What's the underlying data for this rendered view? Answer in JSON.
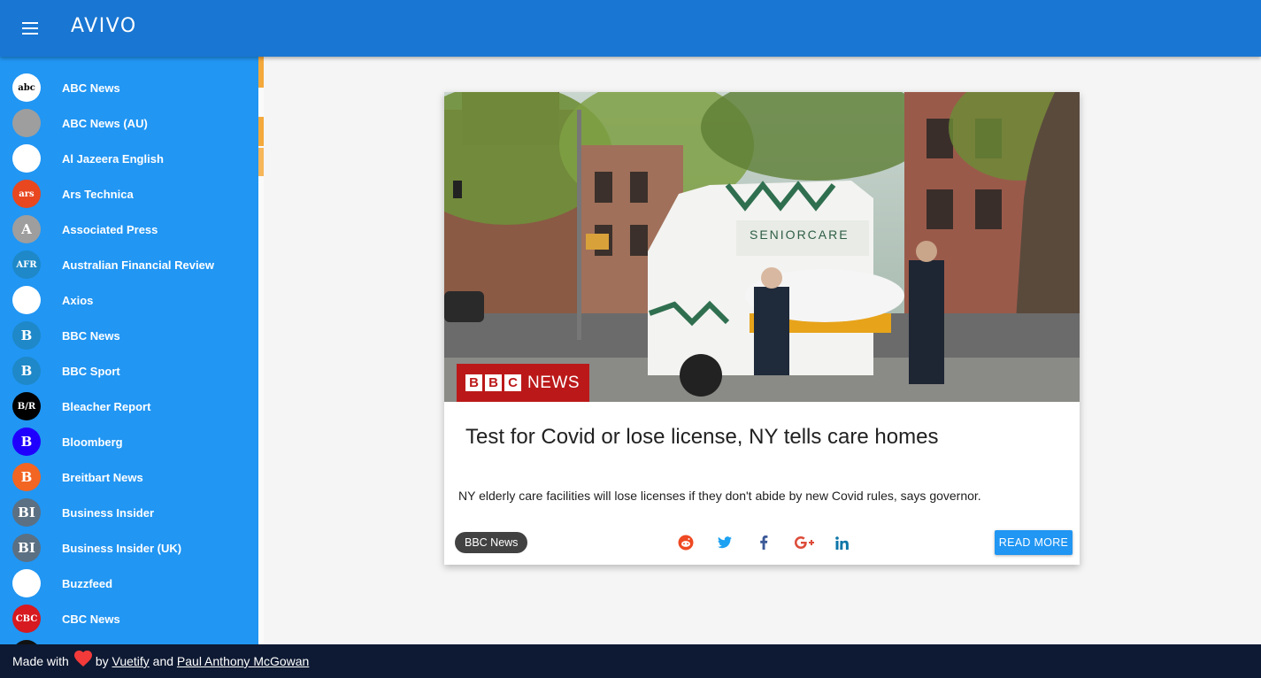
{
  "header": {
    "title": "AVIVO"
  },
  "sidebar": {
    "items": [
      {
        "label": "ABC News",
        "avatar_text": "abc",
        "avatar_icon": "abc-news-logo",
        "bg": "#ffffff",
        "fg": "#000000"
      },
      {
        "label": "ABC News (AU)",
        "avatar_text": "",
        "avatar_icon": "abc-au-logo",
        "bg": "#9e9e9e",
        "fg": "#ffffff"
      },
      {
        "label": "Al Jazeera English",
        "avatar_text": "",
        "avatar_icon": "al-jazeera-logo",
        "bg": "#ffffff",
        "fg": "#d4a017"
      },
      {
        "label": "Ars Technica",
        "avatar_text": "ars",
        "avatar_icon": "ars-technica-logo",
        "bg": "#e8471f",
        "fg": "#ffffff"
      },
      {
        "label": "Associated Press",
        "avatar_text": "A",
        "avatar_icon": "letter-avatar",
        "bg": "#9e9e9e",
        "fg": "#ffffff"
      },
      {
        "label": "Australian Financial Review",
        "avatar_text": "AFR",
        "avatar_icon": "afr-logo",
        "bg": "#1e88c8",
        "fg": "#ffffff"
      },
      {
        "label": "Axios",
        "avatar_text": "",
        "avatar_icon": "axios-logo",
        "bg": "#ffffff",
        "fg": "#000000"
      },
      {
        "label": "BBC News",
        "avatar_text": "B",
        "avatar_icon": "letter-avatar",
        "bg": "#1e88c8",
        "fg": "#ffffff"
      },
      {
        "label": "BBC Sport",
        "avatar_text": "B",
        "avatar_icon": "letter-avatar",
        "bg": "#1e88c8",
        "fg": "#ffffff"
      },
      {
        "label": "Bleacher Report",
        "avatar_text": "B/R",
        "avatar_icon": "bleacher-report-logo",
        "bg": "#000000",
        "fg": "#ffffff"
      },
      {
        "label": "Bloomberg",
        "avatar_text": "B",
        "avatar_icon": "bloomberg-logo",
        "bg": "#1f00ff",
        "fg": "#ffffff"
      },
      {
        "label": "Breitbart News",
        "avatar_text": "B",
        "avatar_icon": "breitbart-logo",
        "bg": "#f26522",
        "fg": "#ffffff"
      },
      {
        "label": "Business Insider",
        "avatar_text": "BI",
        "avatar_icon": "business-insider-logo",
        "bg": "#5b7083",
        "fg": "#ffffff"
      },
      {
        "label": "Business Insider (UK)",
        "avatar_text": "BI",
        "avatar_icon": "business-insider-logo",
        "bg": "#5b7083",
        "fg": "#ffffff"
      },
      {
        "label": "Buzzfeed",
        "avatar_text": "",
        "avatar_icon": "buzzfeed-logo",
        "bg": "#ffffff",
        "fg": "#ee3322"
      },
      {
        "label": "CBC News",
        "avatar_text": "CBC",
        "avatar_icon": "cbc-logo",
        "bg": "#d71920",
        "fg": "#ffffff"
      },
      {
        "label": "",
        "avatar_text": "",
        "avatar_icon": "partial-avatar",
        "bg": "#111111",
        "fg": "#ffffff"
      }
    ]
  },
  "article": {
    "source_logo_letters": [
      "B",
      "B",
      "C"
    ],
    "source_logo_word": "NEWS",
    "title": "Test for Covid or lose license, NY tells care homes",
    "description": "NY elderly care facilities will lose licenses if they don't abide by new Covid rules, says governor.",
    "source_chip": "BBC News",
    "share_icons": [
      "reddit-icon",
      "twitter-icon",
      "facebook-icon",
      "google-plus-icon",
      "linkedin-icon"
    ],
    "read_more_label": "READ MORE",
    "image_text": "SENIORCARE"
  },
  "footer": {
    "made_with": "Made with",
    "by": "by",
    "link1": "Vuetify",
    "and": "and",
    "link2": "Paul Anthony McGowan"
  },
  "colors": {
    "appbar": "#1976d2",
    "drawer": "#2196f3",
    "footer": "#0e1a33",
    "accent_orange": "#f4a93c",
    "read_more": "#2196f3",
    "chip": "#424242",
    "bbc_red": "#bb1919"
  }
}
